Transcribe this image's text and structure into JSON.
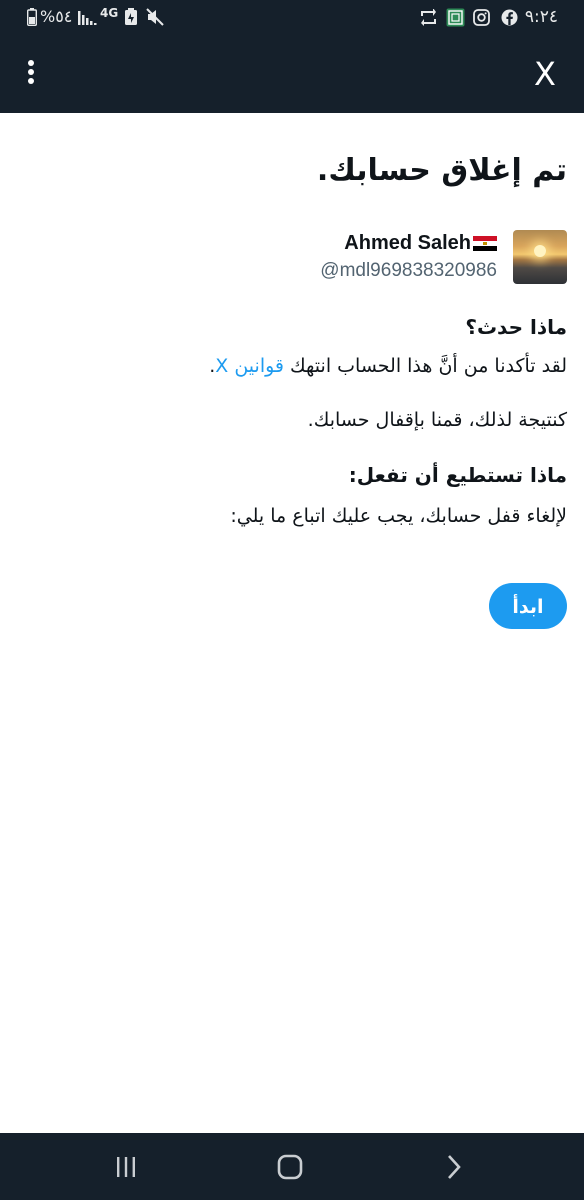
{
  "status_bar": {
    "time": "٩:٢٤",
    "battery_text": "%٥٤",
    "network_label": "4G",
    "icons": [
      "facebook-icon",
      "instagram-icon",
      "app-icon",
      "sync-icon",
      "mute-icon",
      "battery-saver-icon",
      "signal-icon",
      "battery-icon"
    ]
  },
  "app_bar": {
    "close_label": "X",
    "more_icon": "more-vertical-icon"
  },
  "main": {
    "title": "تم إغلاق حسابك.",
    "user": {
      "name": "Ahmed Saleh",
      "handle": "@mdl969838320986",
      "flag": "egypt-flag-icon"
    },
    "what_happened_heading": "ماذا حدث؟",
    "what_happened_text": "لقد تأكدنا من أنَّ هذا الحساب انتهك ",
    "rules_link": "قوانين X",
    "what_happened_end": ".",
    "result_text": "كنتيجة لذلك، قمنا بإقفال حسابك.",
    "what_to_do_heading": "ماذا تستطيع أن تفعل:",
    "what_to_do_text": "لإلغاء قفل حسابك، يجب عليك اتباع ما يلي:",
    "start_button": "ابدأ"
  },
  "nav_bar": {
    "items": [
      "recent-apps-icon",
      "home-icon",
      "back-icon"
    ]
  },
  "colors": {
    "dark_bg": "#15202b",
    "accent": "#1d9bf0",
    "text": "#0f1419",
    "muted": "#536471"
  }
}
